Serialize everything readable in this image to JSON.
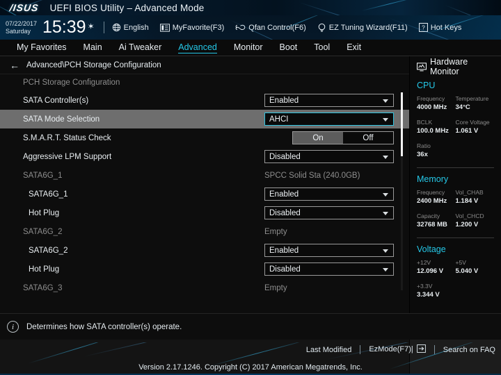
{
  "titlebar": {
    "logo": "/ISUS",
    "title": "UEFI BIOS Utility – Advanced Mode"
  },
  "infobar": {
    "date": "07/22/2017",
    "weekday": "Saturday",
    "time": "15:39",
    "gear_icon": "gear-icon",
    "shortcuts": [
      {
        "label": "English",
        "icon": "globe-icon"
      },
      {
        "label": "MyFavorite(F3)",
        "icon": "list-icon"
      },
      {
        "label": "Qfan Control(F6)",
        "icon": "fan-icon"
      },
      {
        "label": "EZ Tuning Wizard(F11)",
        "icon": "bulb-icon"
      },
      {
        "label": "Hot Keys",
        "icon": "question-box-icon"
      }
    ]
  },
  "tabs": [
    {
      "label": "My Favorites",
      "active": false
    },
    {
      "label": "Main",
      "active": false
    },
    {
      "label": "Ai Tweaker",
      "active": false
    },
    {
      "label": "Advanced",
      "active": true
    },
    {
      "label": "Monitor",
      "active": false
    },
    {
      "label": "Boot",
      "active": false
    },
    {
      "label": "Tool",
      "active": false
    },
    {
      "label": "Exit",
      "active": false
    }
  ],
  "main": {
    "breadcrumb": "Advanced\\PCH Storage Configuration",
    "section_title": "PCH Storage Configuration",
    "rows": [
      {
        "label": "SATA Controller(s)",
        "type": "dropdown",
        "value": "Enabled",
        "selected": false,
        "indent": false,
        "header": false
      },
      {
        "label": "SATA Mode Selection",
        "type": "dropdown",
        "value": "AHCI",
        "selected": true,
        "indent": false,
        "header": false
      },
      {
        "label": "S.M.A.R.T. Status Check",
        "type": "toggle",
        "on_label": "On",
        "off_label": "Off",
        "value": "On",
        "selected": false,
        "indent": false,
        "header": false
      },
      {
        "label": "Aggressive LPM Support",
        "type": "dropdown",
        "value": "Disabled",
        "selected": false,
        "indent": false,
        "header": false
      },
      {
        "label": "SATA6G_1",
        "type": "static",
        "value": "SPCC Solid Sta (240.0GB)",
        "selected": false,
        "indent": false,
        "header": true
      },
      {
        "label": "SATA6G_1",
        "type": "dropdown",
        "value": "Enabled",
        "selected": false,
        "indent": true,
        "header": false
      },
      {
        "label": "Hot Plug",
        "type": "dropdown",
        "value": "Disabled",
        "selected": false,
        "indent": true,
        "header": false
      },
      {
        "label": "SATA6G_2",
        "type": "static",
        "value": "Empty",
        "selected": false,
        "indent": false,
        "header": true
      },
      {
        "label": "SATA6G_2",
        "type": "dropdown",
        "value": "Enabled",
        "selected": false,
        "indent": true,
        "header": false
      },
      {
        "label": "Hot Plug",
        "type": "dropdown",
        "value": "Disabled",
        "selected": false,
        "indent": true,
        "header": false
      },
      {
        "label": "SATA6G_3",
        "type": "static",
        "value": "Empty",
        "selected": false,
        "indent": false,
        "header": true
      }
    ]
  },
  "hardware_monitor": {
    "title": "Hardware Monitor",
    "groups": [
      {
        "name": "CPU",
        "items": [
          {
            "key": "Frequency",
            "value": "4000 MHz"
          },
          {
            "key": "Temperature",
            "value": "34°C"
          },
          {
            "key": "BCLK",
            "value": "100.0 MHz"
          },
          {
            "key": "Core Voltage",
            "value": "1.061 V"
          },
          {
            "key": "Ratio",
            "value": "36x"
          }
        ]
      },
      {
        "name": "Memory",
        "items": [
          {
            "key": "Frequency",
            "value": "2400 MHz"
          },
          {
            "key": "Vol_CHAB",
            "value": "1.184 V"
          },
          {
            "key": "Capacity",
            "value": "32768 MB"
          },
          {
            "key": "Vol_CHCD",
            "value": "1.200 V"
          }
        ]
      },
      {
        "name": "Voltage",
        "items": [
          {
            "key": "+12V",
            "value": "12.096 V"
          },
          {
            "key": "+5V",
            "value": "5.040 V"
          },
          {
            "key": "+3.3V",
            "value": "3.344 V"
          }
        ]
      }
    ]
  },
  "help": {
    "icon": "info-icon",
    "text": "Determines how SATA controller(s) operate."
  },
  "footer": {
    "last_modified": "Last Modified",
    "ezmode": "EzMode(F7)|",
    "search_faq": "Search on FAQ",
    "copyright": "Version 2.17.1246. Copyright (C) 2017 American Megatrends, Inc."
  },
  "colors": {
    "accent": "#25c8e8",
    "selected_row": "#6e6e6e",
    "panel_bg": "#0d0d0d"
  }
}
